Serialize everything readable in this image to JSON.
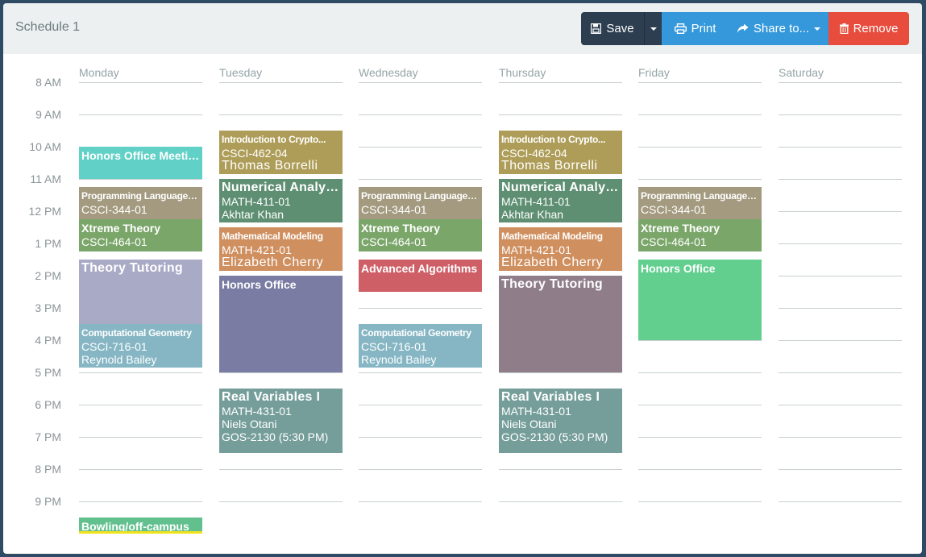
{
  "header": {
    "title": "Schedule 1",
    "buttons": {
      "save": "Save",
      "print": "Print",
      "share": "Share to...",
      "remove": "Remove"
    }
  },
  "times": [
    "8 AM",
    "9 AM",
    "10 AM",
    "11 AM",
    "12 PM",
    "1 PM",
    "2 PM",
    "3 PM",
    "4 PM",
    "5 PM",
    "6 PM",
    "7 PM",
    "8 PM",
    "9 PM"
  ],
  "days": [
    "Monday",
    "Tuesday",
    "Wednesday",
    "Thursday",
    "Friday",
    "Saturday"
  ],
  "events": [
    {
      "day": 0,
      "start": 10.0,
      "end": 11.0,
      "color": "#61d0c6",
      "title": "Honors Office Meeting",
      "tsize": "",
      "lines": []
    },
    {
      "day": 0,
      "start": 11.25,
      "end": 12.25,
      "color": "#a39a7f",
      "title": "Programming Language C...",
      "tsize": "small",
      "lines": [
        "CSCI-344-01"
      ]
    },
    {
      "day": 0,
      "start": 12.25,
      "end": 13.25,
      "color": "#7ba66a",
      "title": "Xtreme Theory",
      "tsize": "",
      "lines": [
        "CSCI-464-01"
      ]
    },
    {
      "day": 0,
      "start": 13.5,
      "end": 15.5,
      "color": "#a9abc6",
      "title": "Theory Tutoring",
      "tsize": "big",
      "lines": []
    },
    {
      "day": 0,
      "start": 15.5,
      "end": 16.85,
      "color": "#86b6c4",
      "title": "Computational Geometry",
      "tsize": "small",
      "lines": [
        "CSCI-716-01",
        "Reynold Bailey"
      ]
    },
    {
      "day": 0,
      "start": 21.5,
      "end": 22.0,
      "color": "#62c08f",
      "title": "Bowling/off-campus",
      "tsize": "",
      "lines": [],
      "underline": "#f1e21b"
    },
    {
      "day": 1,
      "start": 9.5,
      "end": 10.85,
      "color": "#ae9d58",
      "title": "Introduction to Crypto...",
      "tsize": "small",
      "lines": [
        "CSCI-462-04",
        "Thomas Borrelli"
      ],
      "bigLast": true
    },
    {
      "day": 1,
      "start": 11.0,
      "end": 12.35,
      "color": "#5e8f72",
      "title": "Numerical Analysis",
      "tsize": "big",
      "lines": [
        "MATH-411-01",
        "Akhtar Khan"
      ]
    },
    {
      "day": 1,
      "start": 12.5,
      "end": 13.85,
      "color": "#cf8f5f",
      "title": "Mathematical Modeling",
      "tsize": "small",
      "lines": [
        "MATH-421-01",
        "Elizabeth Cherry"
      ],
      "bigLast": true
    },
    {
      "day": 1,
      "start": 14.0,
      "end": 17.0,
      "color": "#7a7ca3",
      "title": "Honors Office",
      "tsize": "",
      "lines": []
    },
    {
      "day": 1,
      "start": 17.5,
      "end": 19.5,
      "color": "#759e9a",
      "title": "Real Variables I",
      "tsize": "big",
      "lines": [
        "MATH-431-01",
        "Niels Otani",
        "GOS-2130 (5:30 PM)"
      ],
      "bigLastPlain": true
    },
    {
      "day": 2,
      "start": 11.25,
      "end": 12.25,
      "color": "#a39a7f",
      "title": "Programming Language C...",
      "tsize": "small",
      "lines": [
        "CSCI-344-01"
      ]
    },
    {
      "day": 2,
      "start": 12.25,
      "end": 13.25,
      "color": "#7ba66a",
      "title": "Xtreme Theory",
      "tsize": "",
      "lines": [
        "CSCI-464-01"
      ]
    },
    {
      "day": 2,
      "start": 13.5,
      "end": 14.5,
      "color": "#cf5f67",
      "title": "Advanced Algorithms",
      "tsize": "",
      "lines": []
    },
    {
      "day": 2,
      "start": 15.5,
      "end": 16.85,
      "color": "#86b6c4",
      "title": "Computational Geometry",
      "tsize": "small",
      "lines": [
        "CSCI-716-01",
        "Reynold Bailey"
      ]
    },
    {
      "day": 3,
      "start": 9.5,
      "end": 10.85,
      "color": "#ae9d58",
      "title": "Introduction to Crypto...",
      "tsize": "small",
      "lines": [
        "CSCI-462-04",
        "Thomas Borrelli"
      ],
      "bigLast": true
    },
    {
      "day": 3,
      "start": 11.0,
      "end": 12.35,
      "color": "#5e8f72",
      "title": "Numerical Analysis",
      "tsize": "big",
      "lines": [
        "MATH-411-01",
        "Akhtar Khan"
      ]
    },
    {
      "day": 3,
      "start": 12.5,
      "end": 13.85,
      "color": "#cf8f5f",
      "title": "Mathematical Modeling",
      "tsize": "small",
      "lines": [
        "MATH-421-01",
        "Elizabeth Cherry"
      ],
      "bigLast": true
    },
    {
      "day": 3,
      "start": 14.0,
      "end": 17.0,
      "color": "#907d8a",
      "title": "Theory Tutoring",
      "tsize": "big",
      "lines": []
    },
    {
      "day": 3,
      "start": 17.5,
      "end": 19.5,
      "color": "#759e9a",
      "title": "Real Variables I",
      "tsize": "big",
      "lines": [
        "MATH-431-01",
        "Niels Otani",
        "GOS-2130 (5:30 PM)"
      ],
      "bigLastPlain": true
    },
    {
      "day": 4,
      "start": 11.25,
      "end": 12.25,
      "color": "#a39a7f",
      "title": "Programming Language C...",
      "tsize": "small",
      "lines": [
        "CSCI-344-01"
      ]
    },
    {
      "day": 4,
      "start": 12.25,
      "end": 13.25,
      "color": "#7ba66a",
      "title": "Xtreme Theory",
      "tsize": "",
      "lines": [
        "CSCI-464-01"
      ]
    },
    {
      "day": 4,
      "start": 13.5,
      "end": 16.0,
      "color": "#62cf8f",
      "title": "Honors Office",
      "tsize": "",
      "lines": []
    }
  ]
}
